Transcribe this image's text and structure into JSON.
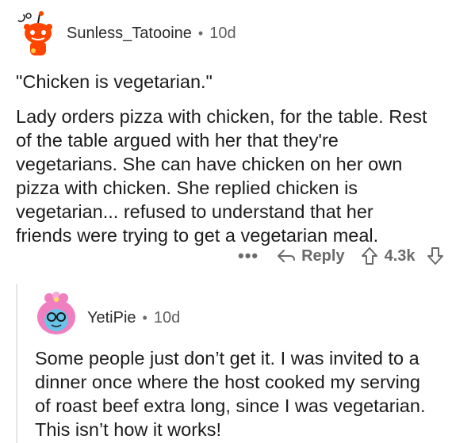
{
  "comment1": {
    "username": "Sunless_Tatooine",
    "separator": "•",
    "time": "10d",
    "title": "\"Chicken is vegetarian.\"",
    "body_lines": [
      "Lady orders pizza with chicken, for the table. Rest",
      "of the table argued with her that they're",
      "vegetarians. She can have chicken on her own",
      "pizza with chicken. She replied chicken is",
      "vegetarian... refused to understand that her",
      "friends were trying to get a vegetarian meal."
    ],
    "actions": {
      "more": "•••",
      "reply": "Reply",
      "votes": "4.3k"
    }
  },
  "comment2": {
    "username": "YetiPie",
    "separator": "•",
    "time": "10d",
    "body_lines": [
      "Some people just don’t get it. I was invited to a",
      "dinner once where the host cooked my serving",
      "of roast beef extra long, since I was vegetarian.",
      "This isn’t how it works!"
    ]
  },
  "colors": {
    "snoo_orange": "#ff4500",
    "avatar2_pink": "#f07fc0",
    "avatar2_blue": "#69c3e8",
    "meta_gray": "#6a6a6a"
  }
}
